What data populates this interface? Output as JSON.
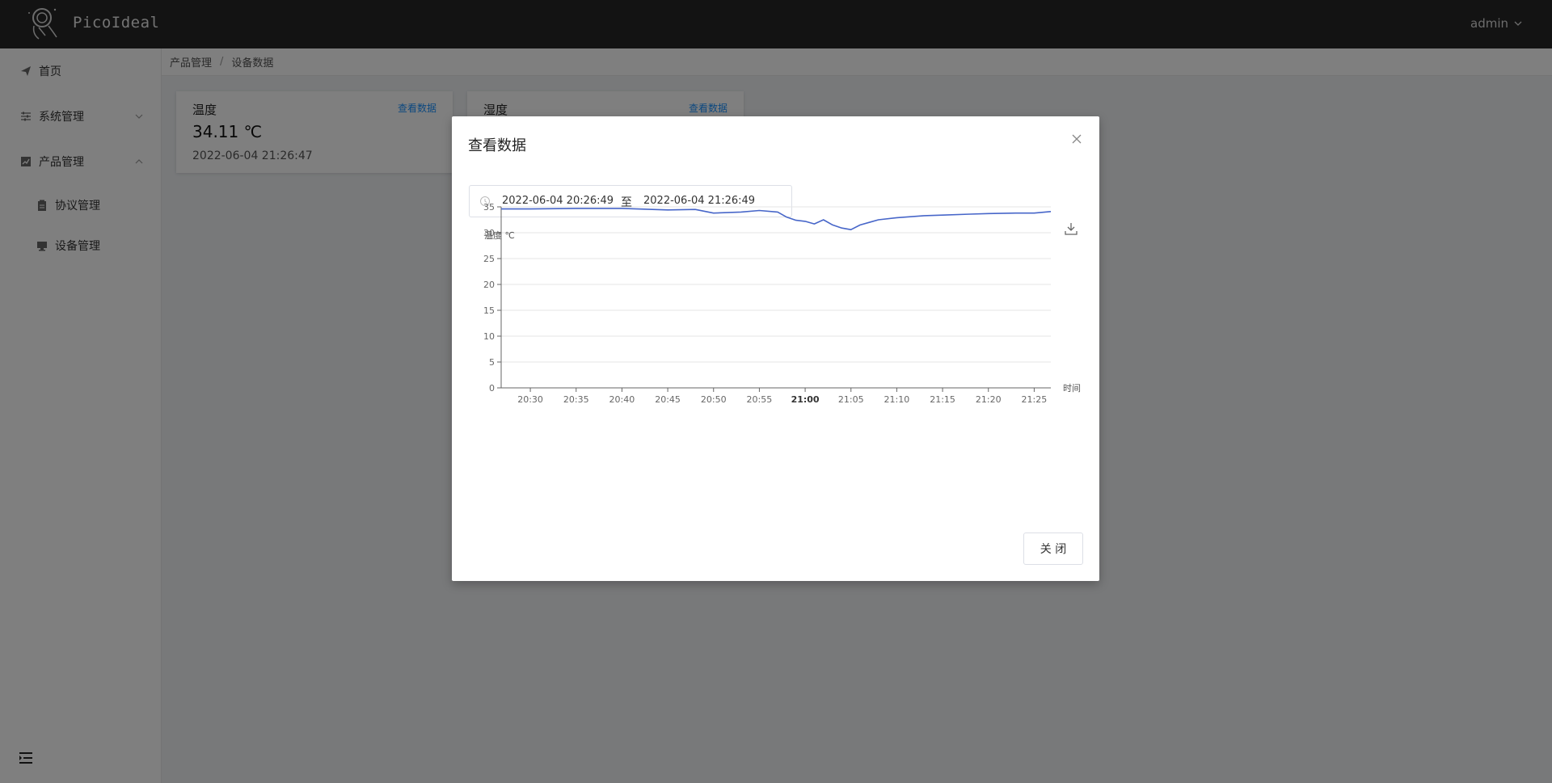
{
  "app": {
    "brand": "PicoIdeal",
    "user": "admin"
  },
  "sidebar": {
    "items": [
      {
        "label": "首页"
      },
      {
        "label": "系统管理"
      },
      {
        "label": "产品管理"
      },
      {
        "label": "协议管理"
      },
      {
        "label": "设备管理"
      }
    ]
  },
  "breadcrumb": {
    "parent": "产品管理",
    "separator": "/",
    "current": "设备数据"
  },
  "cards": [
    {
      "title": "温度",
      "link": "查看数据",
      "value": "34.11 ℃",
      "time": "2022-06-04 21:26:47"
    },
    {
      "title": "湿度",
      "link": "查看数据"
    }
  ],
  "modal": {
    "title": "查看数据",
    "range": {
      "start": "2022-06-04 20:26:49",
      "separator": "至",
      "end": "2022-06-04 21:26:49"
    },
    "close_button": "关 闭"
  },
  "chart_data": {
    "type": "line",
    "title": "",
    "ylabel": "温度 ℃",
    "xlabel": "时间",
    "ylim": [
      0,
      35
    ],
    "yticks": [
      0,
      5,
      10,
      15,
      20,
      25,
      30,
      35
    ],
    "xticks": [
      "20:30",
      "20:35",
      "20:40",
      "20:45",
      "20:50",
      "20:55",
      "21:00",
      "21:05",
      "21:10",
      "21:15",
      "21:20",
      "21:25"
    ],
    "xlim": [
      "20:26:49",
      "21:26:49"
    ],
    "grid": true,
    "colors": {
      "line": "#4766c9"
    },
    "series": [
      {
        "x": [
          "20:26:49",
          "20:30",
          "20:35",
          "20:40",
          "20:45",
          "20:48",
          "20:50",
          "20:53",
          "20:55",
          "20:57",
          "20:58",
          "20:59",
          "21:00",
          "21:01",
          "21:02",
          "21:03",
          "21:04",
          "21:05",
          "21:06",
          "21:07",
          "21:08",
          "21:10",
          "21:13",
          "21:15",
          "21:18",
          "21:20",
          "21:23",
          "21:25",
          "21:26:49"
        ],
        "values": [
          34.6,
          34.6,
          34.7,
          34.7,
          34.4,
          34.5,
          33.8,
          34.0,
          34.3,
          34.0,
          33.0,
          32.4,
          32.2,
          31.7,
          32.5,
          31.5,
          30.9,
          30.6,
          31.5,
          32.0,
          32.5,
          32.9,
          33.3,
          33.4,
          33.6,
          33.7,
          33.8,
          33.8,
          34.1
        ]
      }
    ]
  }
}
